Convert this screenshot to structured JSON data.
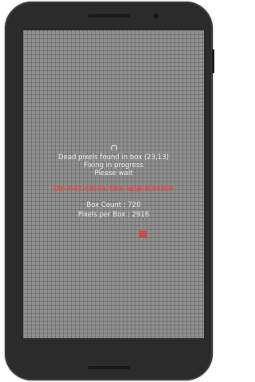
{
  "status": {
    "dead_pixels_message": "Dead pixels found in box (23,13)",
    "progress_message": "Fixing in progress",
    "wait_message": "Please wait"
  },
  "warning": {
    "text": "Do not close the application"
  },
  "stats": {
    "box_count_text": "Box Count : 720",
    "pixels_per_box_text": "Pixels per Box : 2916"
  },
  "icons": {
    "progress": "loading-spinner-icon"
  },
  "colors": {
    "warning_text": "#e84a4a",
    "indicator_box": "#cf4a4a",
    "screen_background": "#909090",
    "phone_frame": "#2b2b2b"
  }
}
